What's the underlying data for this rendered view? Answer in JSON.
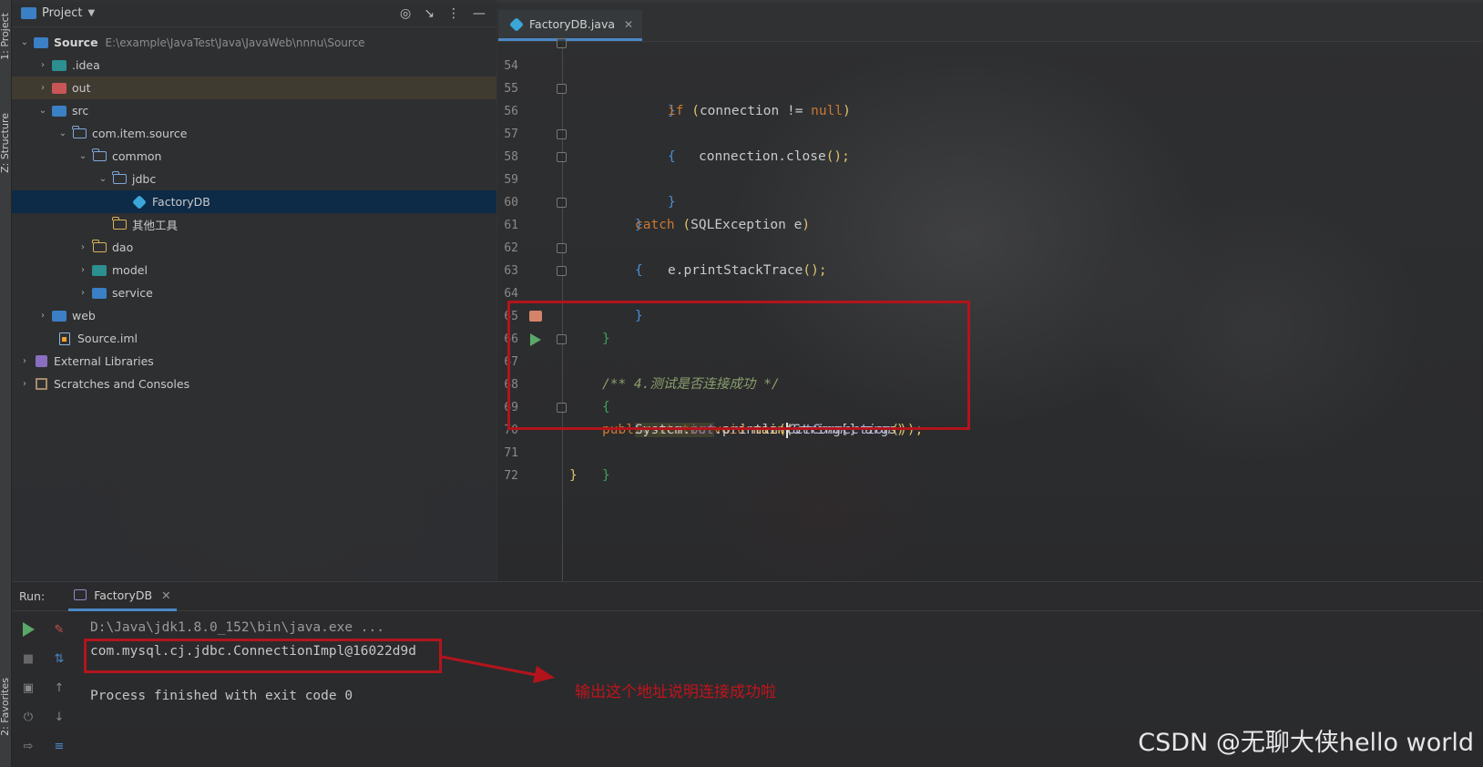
{
  "left_strip": {
    "project_label": "1: Project",
    "structure_label": "Z: Structure",
    "favorites_label": "2: Favorites"
  },
  "project_panel": {
    "title": "Project",
    "tree": [
      {
        "label": "Source",
        "hint": "E:\\example\\JavaTest\\Java\\JavaWeb\\nnnu\\Source"
      },
      {
        "label": ".idea"
      },
      {
        "label": "out"
      },
      {
        "label": "src"
      },
      {
        "label": "com.item.source"
      },
      {
        "label": "common"
      },
      {
        "label": "jdbc"
      },
      {
        "label": "FactoryDB"
      },
      {
        "label": "其他工具"
      },
      {
        "label": "dao"
      },
      {
        "label": "model"
      },
      {
        "label": "service"
      },
      {
        "label": "web"
      },
      {
        "label": "Source.iml"
      },
      {
        "label": "External Libraries"
      },
      {
        "label": "Scratches and Consoles"
      }
    ]
  },
  "editor": {
    "tab_label": "FactoryDB.java",
    "line_numbers": [
      "54",
      "55",
      "56",
      "57",
      "58",
      "59",
      "60",
      "61",
      "62",
      "63",
      "64",
      "65",
      "66",
      "67",
      "68",
      "69",
      "70",
      "71",
      "72"
    ],
    "code": {
      "l54": "}",
      "l55_kw": "if",
      "l55_rest": "connection != ",
      "l55_null": "null",
      "l56": "{",
      "l57": "connection.close",
      "l57_tail": "();",
      "l58": "}",
      "l59": "}",
      "l60_kw": "catch",
      "l60_rest": "SQLException e",
      "l61": "{",
      "l62": "e.printStackTrace",
      "l62_tail": "();",
      "l63": "}",
      "l64": "}",
      "l66": "/** 4.测试是否连接成功 */",
      "l67_kw": "public static void",
      "l67_fn": "main",
      "l67_rest": "String[] args",
      "l68": "{",
      "l69_sys": "System.",
      "l69_out": "out",
      "l69_mid": ".println",
      "l69_call": "GetConnection",
      "l69_tail": "());",
      "l70": "}",
      "l71": "}"
    }
  },
  "run_panel": {
    "label": "Run:",
    "tab_label": "FactoryDB",
    "console": [
      "D:\\Java\\jdk1.8.0_152\\bin\\java.exe ...",
      "com.mysql.cj.jdbc.ConnectionImpl@16022d9d",
      "",
      "Process finished with exit code 0"
    ]
  },
  "annotation": {
    "text": "输出这个地址说明连接成功啦",
    "color": "#c0141c"
  },
  "watermark": "CSDN @无聊大侠hello world"
}
